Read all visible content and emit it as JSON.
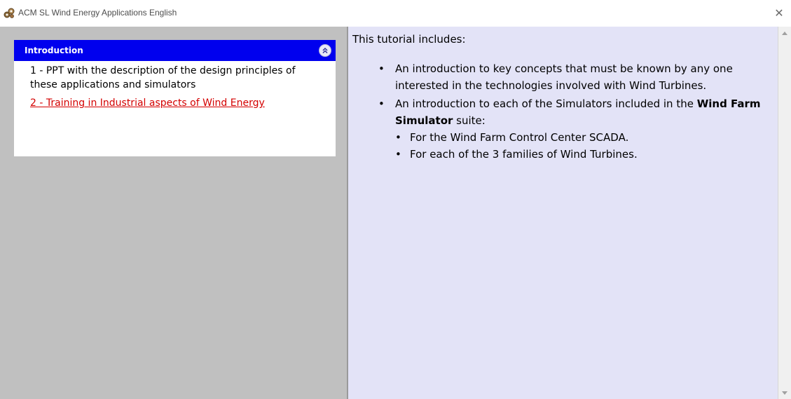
{
  "window": {
    "title": "ACM SL Wind Energy Applications English",
    "app_icon": "gear-cluster-icon",
    "close_glyph": "✕"
  },
  "sidebar": {
    "panel_title": "Introduction",
    "collapse_icon": "double-chevron-up-icon",
    "items": [
      {
        "label": "1 - PPT with the description of the design principles of these applications and simulators"
      },
      {
        "label": "2 - Training in Industrial aspects of Wind Energy"
      }
    ]
  },
  "content": {
    "intro": "This tutorial includes:",
    "bullet1": "An introduction to key concepts that must be known by any one interested in the technologies involved with Wind Turbines.",
    "bullet2_pre": "An introduction to each of the Simulators included in the ",
    "bullet2_bold": "Wind Farm Simulator",
    "bullet2_post": " suite:",
    "sub_items": [
      "For the Wind Farm Control Center SCADA.",
      "For each of the 3 families of Wind Turbines."
    ]
  },
  "colors": {
    "panel_header": "#0000ee",
    "sidebar_bg": "#c0c0c0",
    "content_bg": "#e3e3f7",
    "active_link": "#d40000"
  }
}
